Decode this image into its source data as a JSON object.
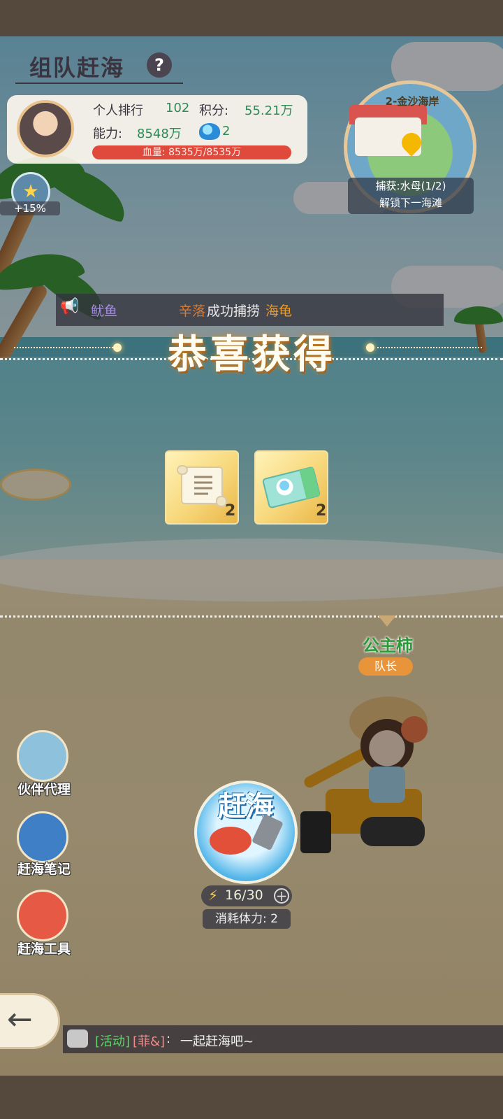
{
  "header": {
    "title": "组队赶海",
    "help_icon": "question-icon"
  },
  "player": {
    "rank_label": "个人排行",
    "rank_value": "102",
    "score_label": "积分:",
    "score_value": "55.21万",
    "power_label": "能力:",
    "power_value": "8548万",
    "wave_count": "2",
    "hp_text": "血量: 8535万/8535万"
  },
  "boost": {
    "icon": "pikachu-boost-icon",
    "percent": "+15%"
  },
  "minimap": {
    "name": "2-金沙海岸",
    "caught": "捕获:水母(1/2)",
    "unlock": "解锁下一海滩"
  },
  "announcement": {
    "icon": "megaphone-icon",
    "prefix": "鱿鱼",
    "player": "辛落",
    "action": "成功捕捞",
    "item": "海龟"
  },
  "reward": {
    "title": "恭喜获得",
    "items": [
      {
        "icon": "scroll-icon",
        "qty": "2"
      },
      {
        "icon": "ticket-icon",
        "qty": "2"
      }
    ]
  },
  "character": {
    "name": "公主柿",
    "badge": "队长"
  },
  "action": {
    "dig_label": "赶海",
    "energy": "16/30",
    "plus": "+",
    "cost": "消耗体力: 2"
  },
  "side_menu": [
    {
      "label": "伙伴代理",
      "icon": "id-card-icon"
    },
    {
      "label": "赶海笔记",
      "icon": "sea-book-icon"
    },
    {
      "label": "赶海工具",
      "icon": "bucket-icon"
    }
  ],
  "chat": {
    "icon": "chat-bubble-icon",
    "channel": "[活动]",
    "sender": "[菲&]",
    "colon": ":",
    "message": "一起赶海吧~"
  },
  "colors": {
    "green_value": "#2e8b57",
    "hp_bar": "#e04a3c",
    "announcement_player": "#e07a2a",
    "announcement_item": "#e89a2a",
    "chat_channel": "#5fd36a",
    "chat_sender": "#f08a8a"
  }
}
